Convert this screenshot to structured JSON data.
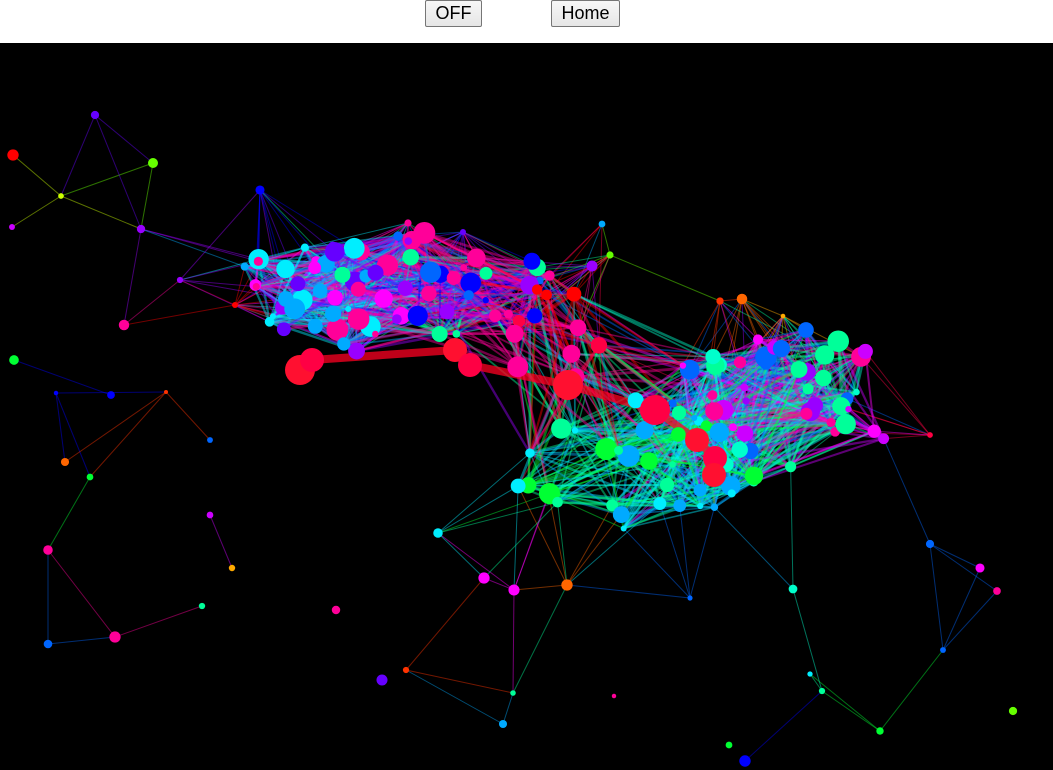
{
  "toolbar": {
    "toggle_label": "OFF",
    "home_label": "Home"
  },
  "visualization": {
    "background_color": "#000000",
    "palette": [
      "#ff0000",
      "#ff3300",
      "#ff6600",
      "#ffaa00",
      "#ffdd00",
      "#ccff00",
      "#66ff00",
      "#00ff33",
      "#00ff99",
      "#00ffcc",
      "#00eeff",
      "#00aaff",
      "#0066ff",
      "#0000ff",
      "#6600ff",
      "#9900ff",
      "#cc00ff",
      "#ff00ff",
      "#ff0099",
      "#ff0044"
    ]
  }
}
